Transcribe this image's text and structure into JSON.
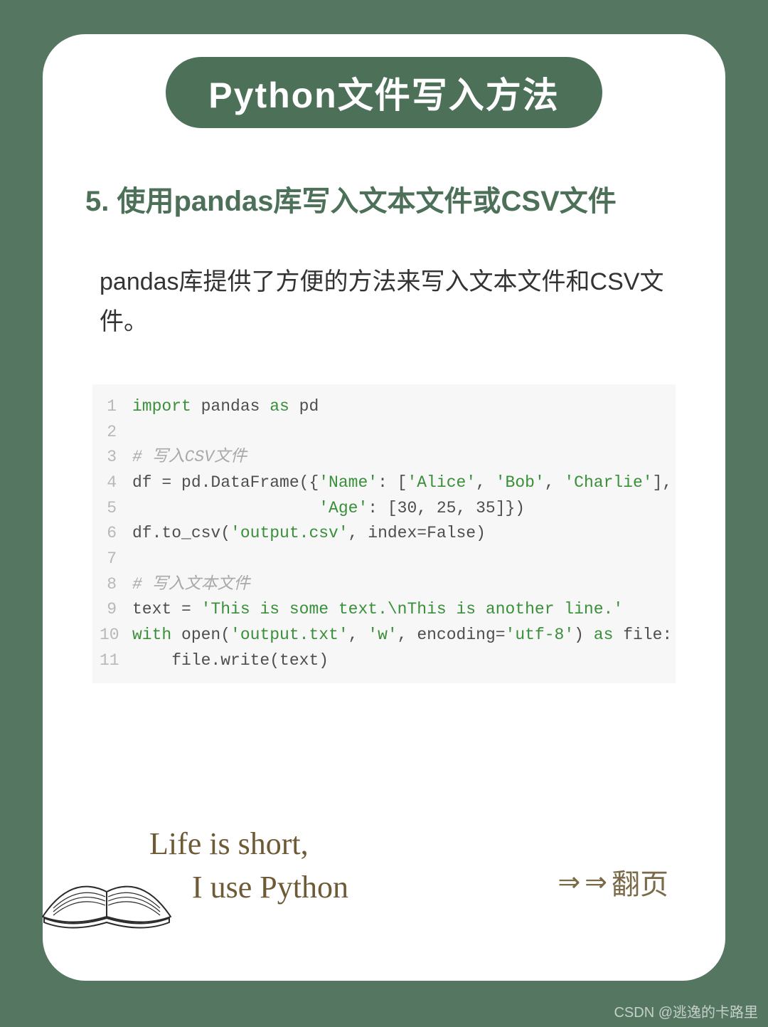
{
  "title": "Python文件写入方法",
  "section": {
    "heading": "5. 使用pandas库写入文本文件或CSV文件",
    "body": "pandas库提供了方便的方法来写入文本文件和CSV文件。"
  },
  "code": {
    "lines": [
      {
        "n": "1",
        "segments": [
          {
            "t": "import",
            "c": "kw"
          },
          {
            "t": " pandas "
          },
          {
            "t": "as",
            "c": "kw"
          },
          {
            "t": " pd"
          }
        ]
      },
      {
        "n": "2",
        "segments": [
          {
            "t": ""
          }
        ]
      },
      {
        "n": "3",
        "segments": [
          {
            "t": "# 写入CSV文件",
            "c": "com"
          }
        ]
      },
      {
        "n": "4",
        "segments": [
          {
            "t": "df = pd.DataFrame({"
          },
          {
            "t": "'Name'",
            "c": "str"
          },
          {
            "t": ": ["
          },
          {
            "t": "'Alice'",
            "c": "str"
          },
          {
            "t": ", "
          },
          {
            "t": "'Bob'",
            "c": "str"
          },
          {
            "t": ", "
          },
          {
            "t": "'Charlie'",
            "c": "str"
          },
          {
            "t": "],"
          }
        ]
      },
      {
        "n": "5",
        "segments": [
          {
            "t": "                   "
          },
          {
            "t": "'Age'",
            "c": "str"
          },
          {
            "t": ": [30, 25, 35]})"
          }
        ]
      },
      {
        "n": "6",
        "segments": [
          {
            "t": "df.to_csv("
          },
          {
            "t": "'output.csv'",
            "c": "str"
          },
          {
            "t": ", index=False)"
          }
        ]
      },
      {
        "n": "7",
        "segments": [
          {
            "t": ""
          }
        ]
      },
      {
        "n": "8",
        "segments": [
          {
            "t": "# 写入文本文件",
            "c": "com"
          }
        ]
      },
      {
        "n": "9",
        "segments": [
          {
            "t": "text = "
          },
          {
            "t": "'This is some text.\\nThis is another line.'",
            "c": "str"
          }
        ]
      },
      {
        "n": "10",
        "segments": [
          {
            "t": "with",
            "c": "kw"
          },
          {
            "t": " open("
          },
          {
            "t": "'output.txt'",
            "c": "str"
          },
          {
            "t": ", "
          },
          {
            "t": "'w'",
            "c": "str"
          },
          {
            "t": ", encoding="
          },
          {
            "t": "'utf-8'",
            "c": "str"
          },
          {
            "t": ") "
          },
          {
            "t": "as",
            "c": "kw"
          },
          {
            "t": " file:"
          }
        ]
      },
      {
        "n": "11",
        "segments": [
          {
            "t": "    file.write(text)"
          }
        ]
      }
    ]
  },
  "footer": {
    "quote_line1": "Life is short,",
    "quote_line2": "I use  Python",
    "page_turn_label": "翻页"
  },
  "watermark": "CSDN @逃逸的卡路里"
}
